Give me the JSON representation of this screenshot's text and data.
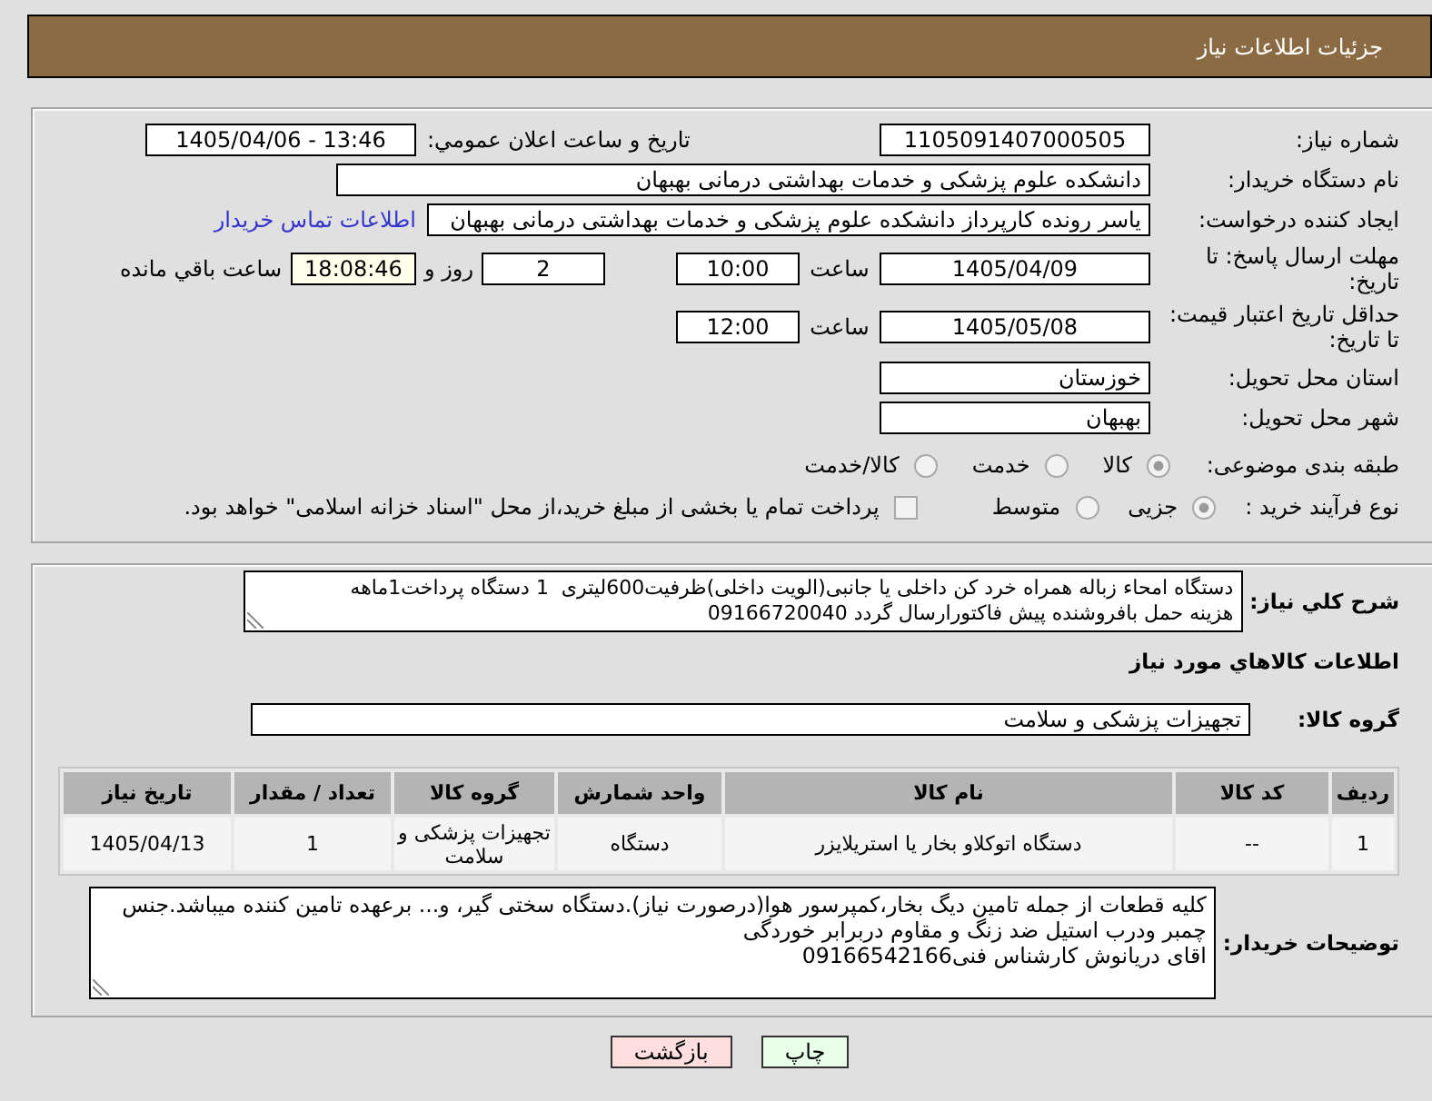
{
  "title": "جزئیات اطلاعات نیاز",
  "details": {
    "need_number": {
      "label": "شماره نیاز:",
      "value": "1105091407000505"
    },
    "announcement": {
      "label": "تاریخ و ساعت اعلان عمومي:",
      "value": "1405/04/06 - 13:46"
    },
    "buyer": {
      "label": "نام دستگاه خریدار:",
      "value": "دانشکده علوم پزشکی و خدمات بهداشتی  درمانی بهبهان"
    },
    "requester": {
      "label": "ایجاد کننده درخواست:",
      "value": "یاسر رونده کارپرداز دانشکده علوم پزشکی و خدمات بهداشتی  درمانی بهبهان",
      "contact_link": "اطلاعات تماس خریدار"
    },
    "reply_deadline": {
      "label": "مهلت ارسال پاسخ: تا تاریخ:",
      "date": "1405/04/09",
      "time_label": "ساعت",
      "time": "10:00",
      "days": "2",
      "days_label": "روز و",
      "remaining": "18:08:46",
      "remaining_label": "ساعت باقي مانده"
    },
    "price_validity": {
      "label": "حداقل تاریخ اعتبار قیمت: تا تاریخ:",
      "date": "1405/05/08",
      "time_label": "ساعت",
      "time": "12:00"
    },
    "province": {
      "label": "استان محل تحویل:",
      "value": "خوزستان"
    },
    "city": {
      "label": "شهر محل تحویل:",
      "value": "بهبهان"
    },
    "category": {
      "label": "طبقه بندی موضوعی:",
      "options": [
        {
          "label": "کالا",
          "selected": true
        },
        {
          "label": "خدمت",
          "selected": false
        },
        {
          "label": "کالا/خدمت",
          "selected": false
        }
      ]
    },
    "purchase_type": {
      "label": "نوع فرآیند خرید :",
      "options": [
        {
          "label": "جزیی",
          "selected": true
        },
        {
          "label": "متوسط",
          "selected": false
        }
      ],
      "treasury": {
        "label": "پرداخت تمام یا بخشی از مبلغ خرید،از محل \"اسناد خزانه اسلامی\" خواهد بود.",
        "checked": false
      }
    }
  },
  "need": {
    "summary": {
      "label": "شرح کلي نیاز:",
      "lines": [
        "دستگاه امحاء زباله همراه خرد کن داخلی یا جانبی(الویت داخلی)ظرفیت600لیتری  1 دستگاه پرداخت1ماهه",
        "هزینه حمل بافروشنده پیش فاکتورارسال گردد 09166720040"
      ]
    },
    "goods_heading": "اطلاعات کالاهاي مورد نیاز",
    "goods_group": {
      "label": "گروه کالا:",
      "value": "تجهیزات پزشکی و سلامت"
    },
    "table": {
      "columns": [
        "ردیف",
        "کد کالا",
        "نام کالا",
        "واحد شمارش",
        "گروه کالا",
        "تعداد / مقدار",
        "تاریخ نیاز"
      ],
      "rows": [
        [
          "1",
          "--",
          "دستگاه اتوکلاو بخار یا استریلایزر",
          "دستگاه",
          "تجهیزات پزشکی و سلامت",
          "1",
          "1405/04/13"
        ]
      ]
    },
    "buyer_notes": {
      "label": "توضیحات خریدار:",
      "lines": [
        "کلیه قطعات از جمله تامین دیگ بخار،کمپرسور هوا(درصورت نیاز).دستگاه سختی گیر، و... برعهده تامین کننده میباشد.جنس",
        "چمبر ودرب استیل ضد زنگ و مقاوم دربرابر خوردگی",
        "اقای دریانوش کارشناس فنی09166542166"
      ]
    }
  },
  "buttons": [
    {
      "label": "چاپ",
      "kind": "print"
    },
    {
      "label": "بازگشت",
      "kind": "back"
    }
  ]
}
